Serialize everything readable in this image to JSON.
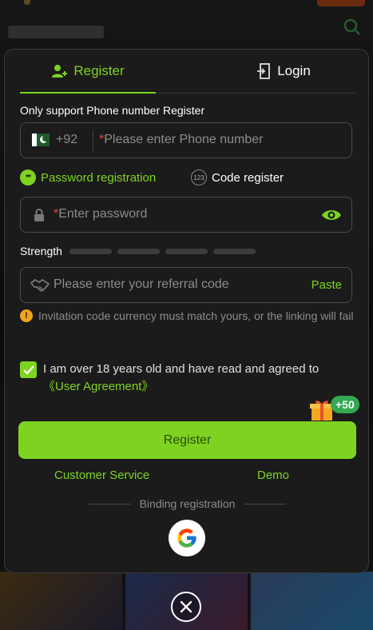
{
  "tabs": {
    "register": "Register",
    "login": "Login"
  },
  "phone": {
    "label": "Only support Phone number Register",
    "dial_code": "+92",
    "required_mark": "*",
    "placeholder": "Please enter Phone number"
  },
  "registration_options": {
    "password": "Password registration",
    "code": "Code register",
    "password_icon_text": "**",
    "code_icon_text": "123"
  },
  "password": {
    "required_mark": "*",
    "placeholder": "Enter password"
  },
  "strength": {
    "label": "Strength",
    "level": 0,
    "segments": 4
  },
  "referral": {
    "placeholder": "Please enter your referral code",
    "paste": "Paste"
  },
  "warning": {
    "text": "Invitation code currency must match yours, or the linking will fail"
  },
  "agreement": {
    "checked": true,
    "text": "I am over 18 years old and have read and agreed to ",
    "link": "《User Agreement》"
  },
  "bonus": {
    "badge": "+50"
  },
  "register_button": "Register",
  "links": {
    "customer_service": "Customer Service",
    "demo": "Demo"
  },
  "binding": {
    "label": "Binding registration"
  },
  "colors": {
    "accent": "#7ed321",
    "warning": "#f0a31d",
    "required": "#e0453a",
    "modal_bg": "#1b1b1b"
  },
  "icons": [
    "user-plus-icon",
    "login-icon",
    "pakistan-flag-icon",
    "lock-icon",
    "eye-icon",
    "handshake-icon",
    "warning-icon",
    "check-icon",
    "gift-icon",
    "google-icon",
    "close-icon"
  ]
}
